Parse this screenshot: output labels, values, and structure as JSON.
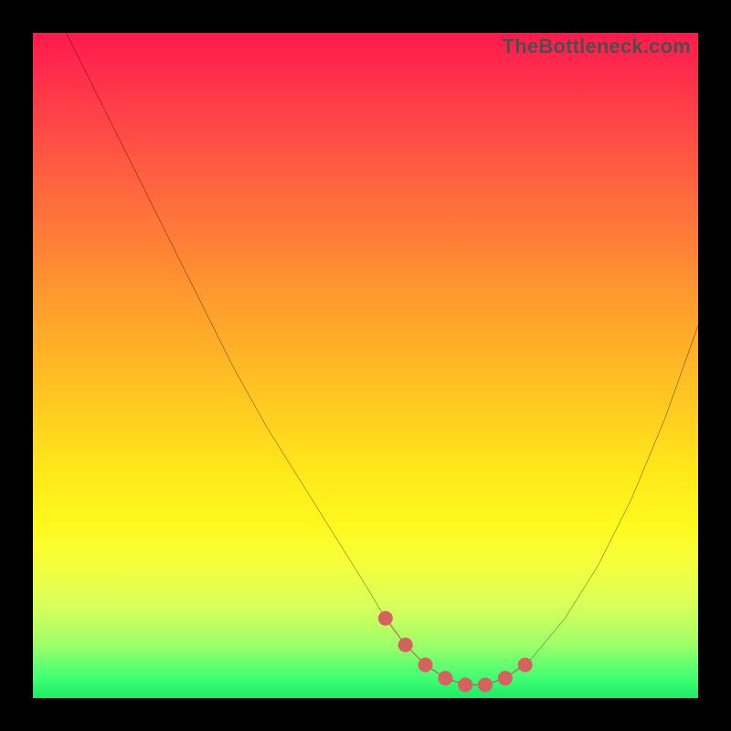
{
  "watermark": "TheBottleneck.com",
  "chart_data": {
    "type": "line",
    "title": "",
    "xlabel": "",
    "ylabel": "",
    "xlim": [
      0,
      100
    ],
    "ylim": [
      0,
      100
    ],
    "series": [
      {
        "name": "bottleneck-curve",
        "x": [
          5,
          10,
          15,
          20,
          25,
          30,
          35,
          40,
          45,
          50,
          53,
          56,
          59,
          62,
          65,
          68,
          71,
          75,
          80,
          85,
          90,
          95,
          100
        ],
        "values": [
          100,
          90,
          80,
          70,
          60,
          50,
          41,
          33,
          25,
          17,
          12,
          8,
          5,
          3,
          2,
          2,
          3,
          6,
          12,
          20,
          30,
          42,
          56
        ]
      }
    ],
    "markers": {
      "name": "highlighted-segment",
      "color": "#d7615e",
      "x": [
        53,
        56,
        59,
        62,
        65,
        68,
        71,
        74
      ],
      "values": [
        12,
        8,
        5,
        3,
        2,
        2,
        3,
        5
      ]
    },
    "background_gradient": {
      "top": "#ff1a4d",
      "middle": "#ffe81a",
      "bottom": "#1dea66"
    }
  }
}
